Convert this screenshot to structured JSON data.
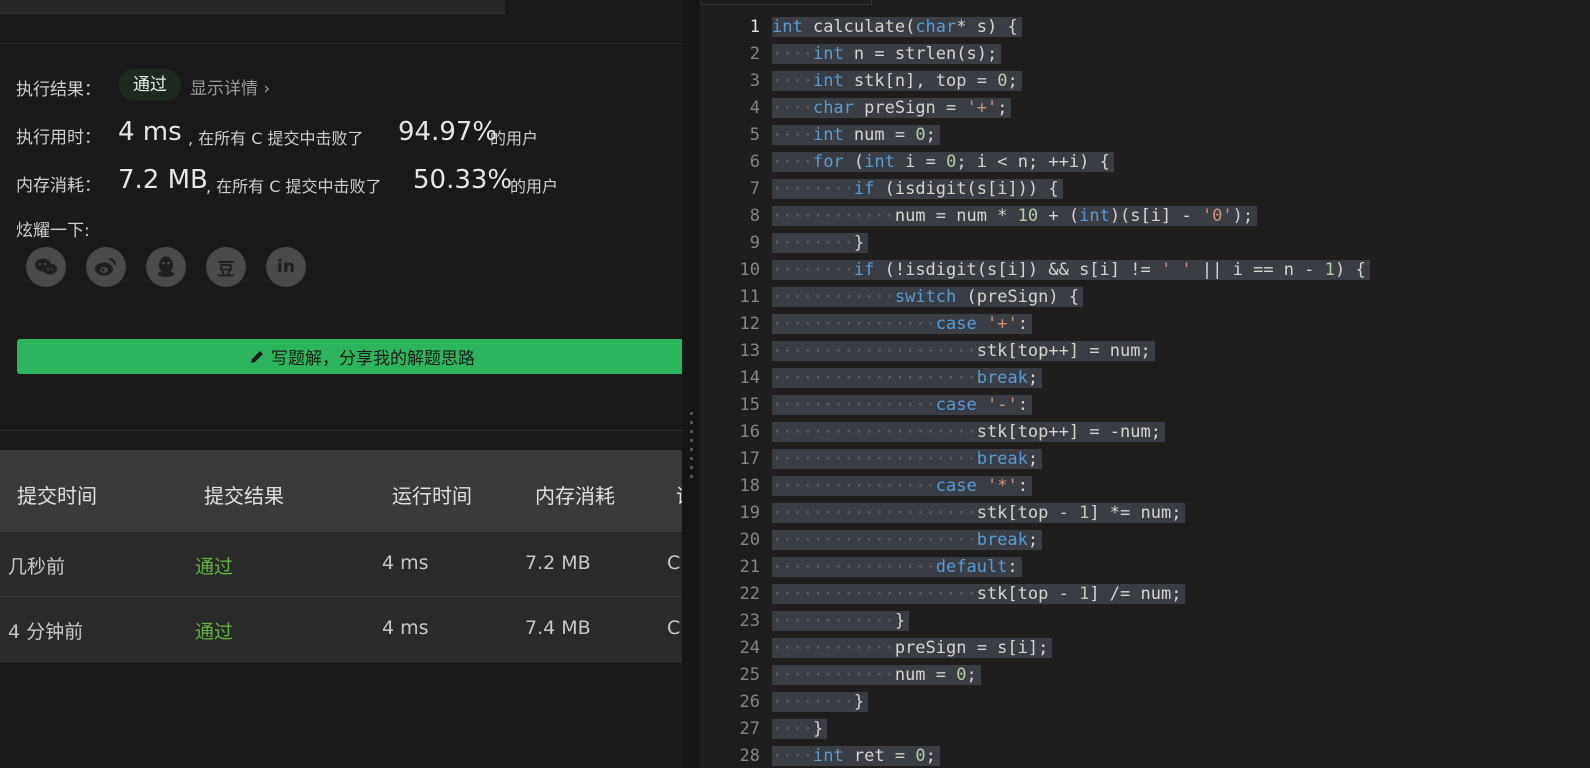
{
  "result": {
    "exec_label": "执行结果：",
    "badge": "通过",
    "detail": "显示详情 ›",
    "time_label": "执行用时：",
    "time_value": "4 ms",
    "time_text": ", 在所有 C 提交中击败了",
    "time_pct": "94.97%",
    "time_suffix": "的用户",
    "mem_label": "内存消耗：",
    "mem_value": "7.2 MB",
    "mem_text": ", 在所有 C 提交中击败了",
    "mem_pct": "50.33%",
    "mem_suffix": "的用户",
    "share_label": "炫耀一下:",
    "share_icons": [
      "wechat-icon",
      "weibo-icon",
      "qq-icon",
      "douban-icon",
      "linkedin-icon"
    ],
    "douban_glyph": "豆",
    "linkedin_glyph": "in",
    "write_button": "写题解，分享我的解题思路"
  },
  "table": {
    "headers": [
      "提交时间",
      "提交结果",
      "运行时间",
      "内存消耗",
      "语"
    ],
    "rows": [
      {
        "time": "几秒前",
        "status": "通过",
        "runtime": "4 ms",
        "memory": "7.2 MB",
        "lang": "C"
      },
      {
        "time": "4 分钟前",
        "status": "通过",
        "runtime": "4 ms",
        "memory": "7.4 MB",
        "lang": "C"
      }
    ]
  },
  "editor": {
    "current_line": 1,
    "lines": [
      {
        "n": 1,
        "t": "int calculate(char* s) {"
      },
      {
        "n": 2,
        "t": "    int n = strlen(s);"
      },
      {
        "n": 3,
        "t": "    int stk[n], top = 0;"
      },
      {
        "n": 4,
        "t": "    char preSign = '+';"
      },
      {
        "n": 5,
        "t": "    int num = 0;"
      },
      {
        "n": 6,
        "t": "    for (int i = 0; i < n; ++i) {"
      },
      {
        "n": 7,
        "t": "        if (isdigit(s[i])) {"
      },
      {
        "n": 8,
        "t": "            num = num * 10 + (int)(s[i] - '0');"
      },
      {
        "n": 9,
        "t": "        }"
      },
      {
        "n": 10,
        "t": "        if (!isdigit(s[i]) && s[i] != ' ' || i == n - 1) {"
      },
      {
        "n": 11,
        "t": "            switch (preSign) {"
      },
      {
        "n": 12,
        "t": "                case '+':"
      },
      {
        "n": 13,
        "t": "                    stk[top++] = num;"
      },
      {
        "n": 14,
        "t": "                    break;"
      },
      {
        "n": 15,
        "t": "                case '-':"
      },
      {
        "n": 16,
        "t": "                    stk[top++] = -num;"
      },
      {
        "n": 17,
        "t": "                    break;"
      },
      {
        "n": 18,
        "t": "                case '*':"
      },
      {
        "n": 19,
        "t": "                    stk[top - 1] *= num;"
      },
      {
        "n": 20,
        "t": "                    break;"
      },
      {
        "n": 21,
        "t": "                default:"
      },
      {
        "n": 22,
        "t": "                    stk[top - 1] /= num;"
      },
      {
        "n": 23,
        "t": "            }"
      },
      {
        "n": 24,
        "t": "            preSign = s[i];"
      },
      {
        "n": 25,
        "t": "            num = 0;"
      },
      {
        "n": 26,
        "t": "        }"
      },
      {
        "n": 27,
        "t": "    }"
      },
      {
        "n": 28,
        "t": "    int ret = 0;"
      }
    ]
  }
}
